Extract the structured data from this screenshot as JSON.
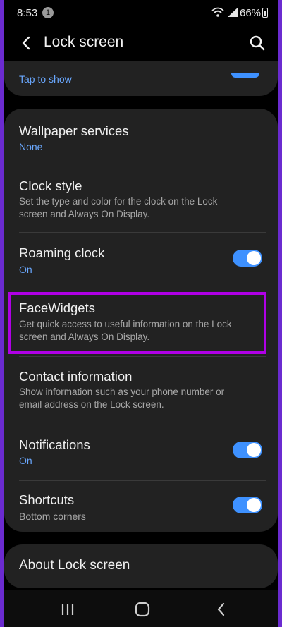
{
  "status": {
    "time": "8:53",
    "notification_count": "1",
    "battery": "66%"
  },
  "header": {
    "title": "Lock screen"
  },
  "top_item": {
    "subtitle": "Tap to show",
    "toggle_on": true
  },
  "items": [
    {
      "title": "Wallpaper services",
      "subtitle": "None"
    },
    {
      "title": "Clock style",
      "description": "Set the type and color for the clock on the Lock screen and Always On Display."
    },
    {
      "title": "Roaming clock",
      "subtitle": "On",
      "toggle_on": true
    },
    {
      "title": "FaceWidgets",
      "description": "Get quick access to useful information on the Lock screen and Always On Display."
    },
    {
      "title": "Contact information",
      "description": "Show information such as your phone number or email address on the Lock screen."
    },
    {
      "title": "Notifications",
      "subtitle": "On",
      "toggle_on": true
    },
    {
      "title": "Shortcuts",
      "subtitle": "Bottom corners",
      "toggle_on": true
    }
  ],
  "about": {
    "label": "About Lock screen"
  },
  "icons": {
    "back": "back-arrow-icon",
    "search": "search-icon",
    "recents": "recents-icon",
    "home": "home-icon",
    "nav_back": "nav-back-icon"
  },
  "colors": {
    "accent": "#3e91ff",
    "highlight": "#b000e6",
    "card": "#222222",
    "background": "#000000"
  }
}
